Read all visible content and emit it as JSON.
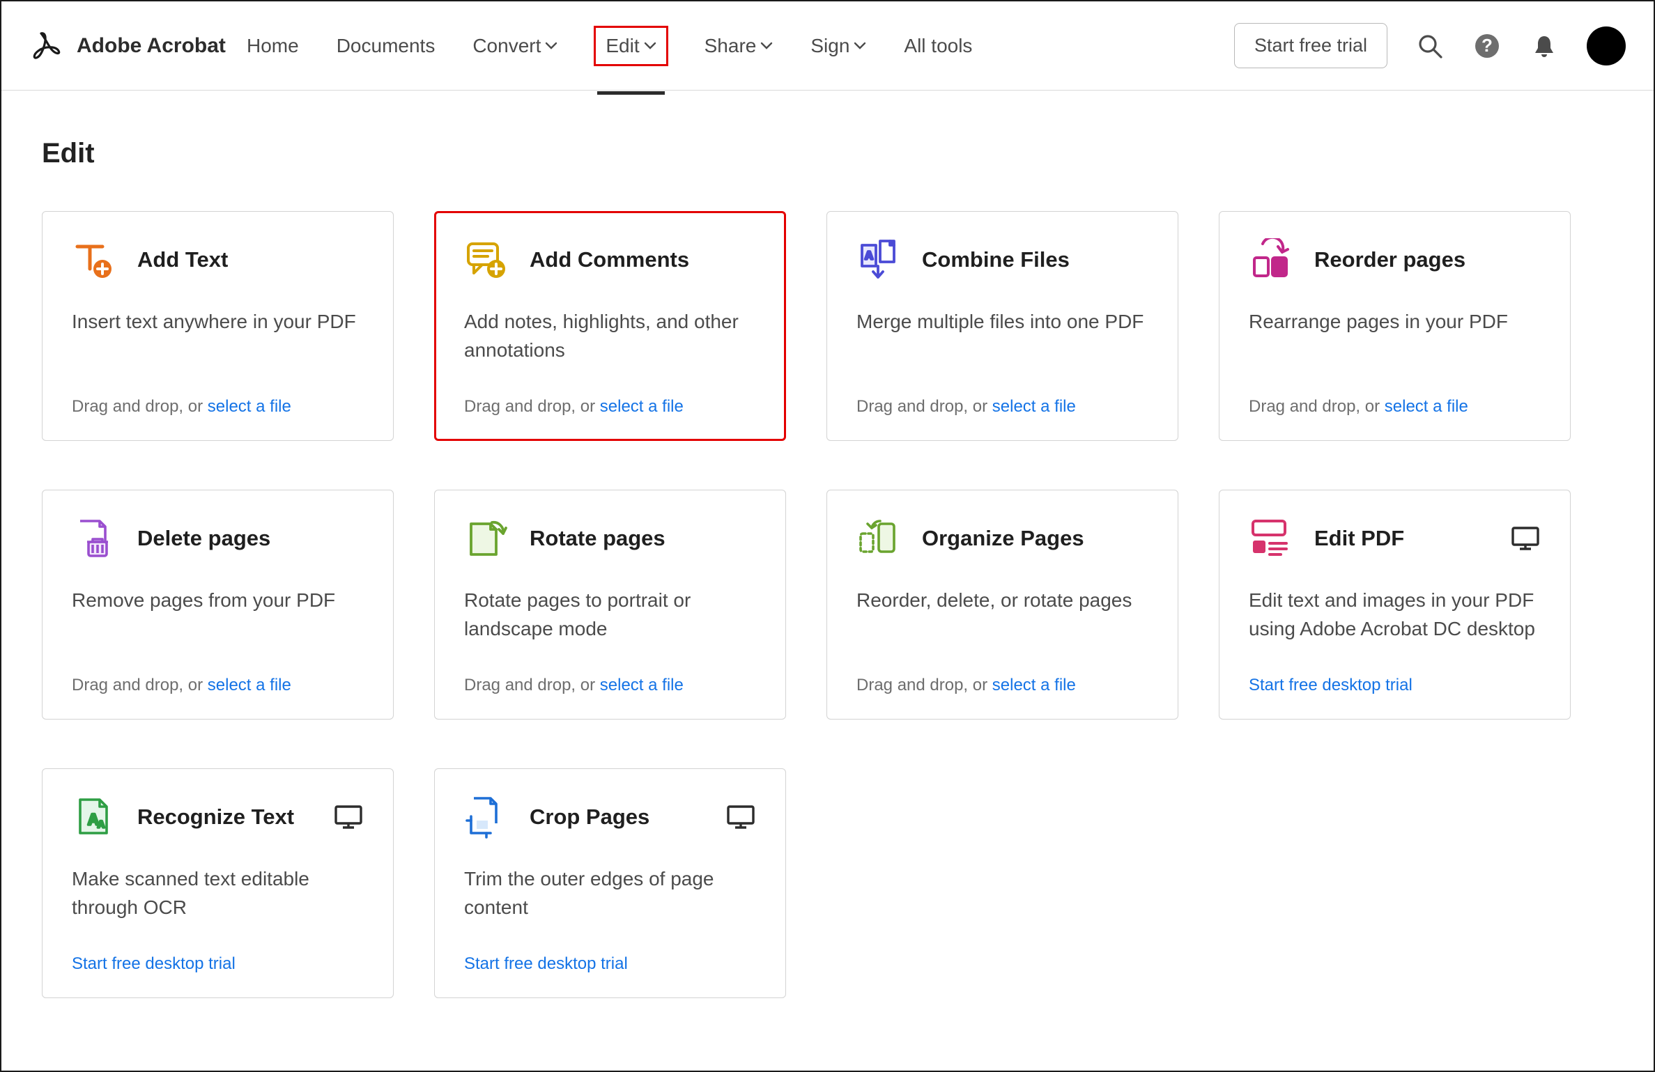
{
  "brand": {
    "name": "Adobe Acrobat"
  },
  "nav": {
    "home": "Home",
    "documents": "Documents",
    "convert": "Convert",
    "edit": "Edit",
    "share": "Share",
    "sign": "Sign",
    "alltools": "All tools"
  },
  "header": {
    "trial": "Start free trial"
  },
  "page": {
    "title": "Edit"
  },
  "cards": {
    "addText": {
      "title": "Add Text",
      "desc": "Insert text anywhere in your PDF",
      "dropPre": "Drag and drop, or ",
      "dropLink": "select a file"
    },
    "addComments": {
      "title": "Add Comments",
      "desc": "Add notes, highlights, and other annotations",
      "dropPre": "Drag and drop, or ",
      "dropLink": "select a file"
    },
    "combine": {
      "title": "Combine Files",
      "desc": "Merge multiple files into one PDF",
      "dropPre": "Drag and drop, or ",
      "dropLink": "select a file"
    },
    "reorder": {
      "title": "Reorder pages",
      "desc": "Rearrange pages in your PDF",
      "dropPre": "Drag and drop, or ",
      "dropLink": "select a file"
    },
    "delete": {
      "title": "Delete pages",
      "desc": "Remove pages from your PDF",
      "dropPre": "Drag and drop, or ",
      "dropLink": "select a file"
    },
    "rotate": {
      "title": "Rotate pages",
      "desc": "Rotate pages to portrait or landscape mode",
      "dropPre": "Drag and drop, or ",
      "dropLink": "select a file"
    },
    "organize": {
      "title": "Organize Pages",
      "desc": "Reorder, delete, or rotate pages",
      "dropPre": "Drag and drop, or ",
      "dropLink": "select a file"
    },
    "editpdf": {
      "title": "Edit PDF",
      "desc": "Edit text and images in your PDF using Adobe Acrobat DC desktop",
      "link": "Start free desktop trial"
    },
    "recognize": {
      "title": "Recognize Text",
      "desc": "Make scanned text editable through OCR",
      "link": "Start free desktop trial"
    },
    "crop": {
      "title": "Crop Pages",
      "desc": "Trim the outer edges of page content",
      "link": "Start free desktop trial"
    }
  }
}
